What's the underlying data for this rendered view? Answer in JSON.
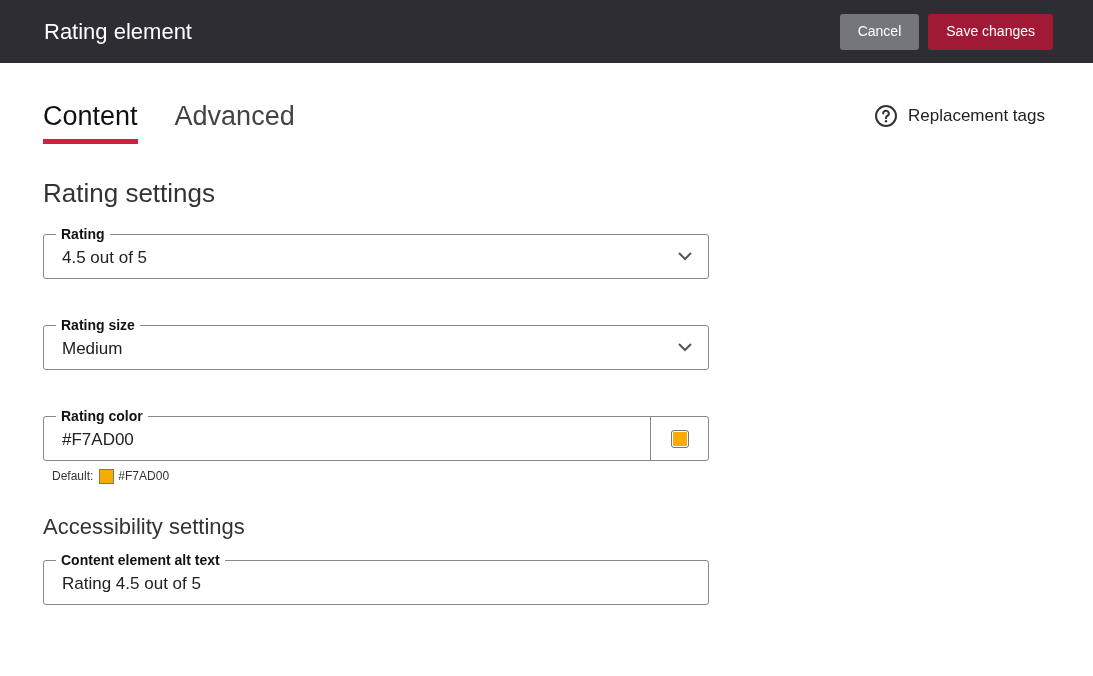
{
  "header": {
    "title": "Rating element",
    "buttons": [
      {
        "label": "Cancel",
        "kind": "secondary"
      },
      {
        "label": "Save changes",
        "kind": "primary"
      }
    ]
  },
  "tabs": [
    {
      "label": "Content",
      "selected": true
    },
    {
      "label": "Advanced",
      "selected": false
    }
  ],
  "help_link": {
    "label": "Replacement tags"
  },
  "sections": [
    {
      "heading": "Rating settings",
      "fields": [
        {
          "kind": "select",
          "label": "Rating",
          "value": "4.5 out of 5"
        },
        {
          "kind": "select",
          "label": "Rating size",
          "value": "Medium"
        },
        {
          "kind": "color",
          "label": "Rating color",
          "value": "#F7AD00",
          "default_label": "Default:",
          "default_value": "#F7AD00"
        }
      ]
    },
    {
      "heading": "Accessibility settings",
      "fields": [
        {
          "kind": "text",
          "label": "Content element alt text",
          "value": "Rating 4.5 out of 5"
        }
      ]
    }
  ]
}
